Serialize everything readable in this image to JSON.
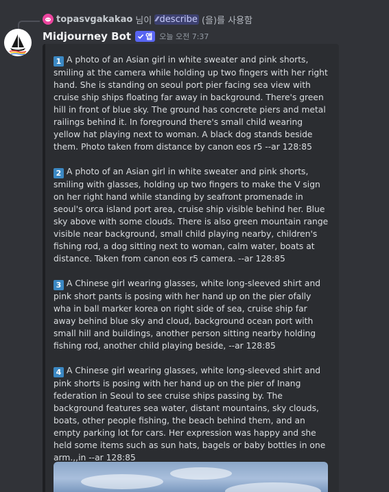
{
  "reply": {
    "username": "topasvgakakao",
    "connector": "님이",
    "command": "describe",
    "suffix": "(을)를 사용함"
  },
  "message": {
    "bot_name": "Midjourney Bot",
    "badge_label": "앱",
    "timestamp": "오늘 오전 7:37"
  },
  "descriptions": [
    {
      "num": "1",
      "text": "A photo of an Asian girl in white sweater and pink shorts, smiling at the camera while holding up two fingers with her right hand. She is standing on seoul port pier facing sea view with cruise ship ships floating far away in background. There's green hill in front of blue sky. The ground has concrete piers and metal railings behind it. In foreground there's small child wearing yellow hat playing next to woman. A black dog stands beside them. Photo taken from distance by canon eos r5 --ar 128:85"
    },
    {
      "num": "2",
      "text": "A photo of an Asian girl in white sweater and pink shorts, smiling with glasses, holding up two fingers to make the V sign on her right hand while standing by seafront promenade in seoul's orca island port area, cruise ship visible behind her. Blue sky above with some clouds. There is also green mountain range visible near background, small child playing nearby, children's fishing rod, a dog sitting next to woman, calm water, boats at distance. Taken from canon eos r5 camera. --ar 128:85"
    },
    {
      "num": "3",
      "text": "A Chinese girl wearing glasses, white long-sleeved shirt and pink short pants is posing with her hand up on the pier ofally wha in ball marker korea on right side of sea, cruise ship far away behind blue sky and cloud, background ocean port with small hill and buildings, another person sitting nearby holding fishing rod, another child playing beside, --ar 128:85"
    },
    {
      "num": "4",
      "text": "A Chinese girl wearing glasses, white long-sleeved shirt and pink shorts is posing with her hand up on the pier of Inang federation in Seoul to see cruise ships passing by. The background features sea water, distant mountains, sky clouds, boats, other people fishing, the beach behind them, and an empty parking lot for cars. Her expression was happy and she held some items such as sun hats, bagels or baby bottles in one arm.,,in --ar 128:85"
    }
  ],
  "icons": {
    "reply_avatar": "discord-logo-icon",
    "bot_avatar": "sailboat-logo-icon",
    "badge": "checkmark-icon",
    "command": "slash-command-icon"
  },
  "colors": {
    "background": "#313338",
    "embed": "#2b2d31",
    "accent": "#5865f2",
    "number_badge": "#3b88c3"
  }
}
